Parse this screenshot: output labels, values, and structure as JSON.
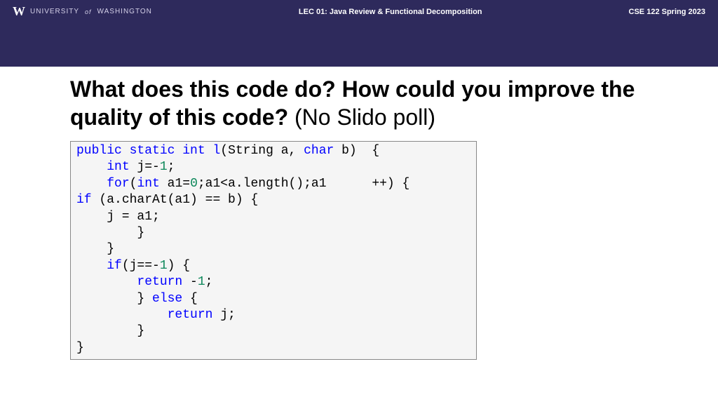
{
  "header": {
    "university_w": "W",
    "university_text_1": "UNIVERSITY",
    "university_of": "of",
    "university_text_2": "WASHINGTON",
    "lecture": "LEC 01: Java Review & Functional Decomposition",
    "course": "CSE 122 Spring 2023"
  },
  "title": {
    "bold": "What does this code do? How could you improve the quality of this code?",
    "normal": " (No Slido poll)"
  },
  "code": {
    "tokens": [
      {
        "text": "public",
        "cls": "kw"
      },
      {
        "text": " "
      },
      {
        "text": "static",
        "cls": "kw"
      },
      {
        "text": " "
      },
      {
        "text": "int",
        "cls": "kw"
      },
      {
        "text": " "
      },
      {
        "text": "l",
        "cls": "fn"
      },
      {
        "text": "(String a, "
      },
      {
        "text": "char",
        "cls": "kw"
      },
      {
        "text": " b)  {\n"
      },
      {
        "text": "    "
      },
      {
        "text": "int",
        "cls": "kw"
      },
      {
        "text": " j=-"
      },
      {
        "text": "1",
        "cls": "num"
      },
      {
        "text": ";\n"
      },
      {
        "text": "    "
      },
      {
        "text": "for",
        "cls": "kw"
      },
      {
        "text": "("
      },
      {
        "text": "int",
        "cls": "kw"
      },
      {
        "text": " a1="
      },
      {
        "text": "0",
        "cls": "num"
      },
      {
        "text": ";a1<a.length();a1      ++) {\n"
      },
      {
        "text": "if",
        "cls": "kw"
      },
      {
        "text": " (a.charAt(a1) == b) {\n"
      },
      {
        "text": "    j = a1;\n"
      },
      {
        "text": "        }\n"
      },
      {
        "text": "    }\n"
      },
      {
        "text": "    "
      },
      {
        "text": "if",
        "cls": "kw"
      },
      {
        "text": "(j==-"
      },
      {
        "text": "1",
        "cls": "num"
      },
      {
        "text": ") {\n"
      },
      {
        "text": "        "
      },
      {
        "text": "return",
        "cls": "kw"
      },
      {
        "text": " -"
      },
      {
        "text": "1",
        "cls": "num"
      },
      {
        "text": ";\n"
      },
      {
        "text": "        } "
      },
      {
        "text": "else",
        "cls": "kw"
      },
      {
        "text": " {\n"
      },
      {
        "text": "            "
      },
      {
        "text": "return",
        "cls": "kw"
      },
      {
        "text": " j;\n"
      },
      {
        "text": "        }\n"
      },
      {
        "text": "}"
      }
    ]
  }
}
